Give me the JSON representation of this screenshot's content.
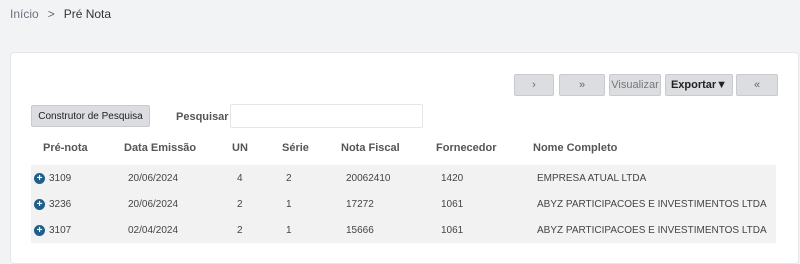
{
  "breadcrumb": {
    "home": "Início",
    "separator": ">",
    "current": "Pré Nota"
  },
  "toolbar": {
    "next": "›",
    "last": "»",
    "visualize": "Visualizar",
    "export": "Exportar▼",
    "collapse": "«"
  },
  "search": {
    "builder_label": "Construtor de Pesquisa",
    "label": "Pesquisar",
    "value": "",
    "placeholder": ""
  },
  "table": {
    "columns": [
      "Pré-nota",
      "Data Emissão",
      "UN",
      "Série",
      "Nota Fiscal",
      "Fornecedor",
      "Nome Completo"
    ],
    "rows": [
      [
        "3109",
        "20/06/2024",
        "4",
        "2",
        "20062410",
        "1420",
        "EMPRESA ATUAL LTDA"
      ],
      [
        "3236",
        "20/06/2024",
        "2",
        "1",
        "17272",
        "1061",
        "ABYZ PARTICIPACOES E INVESTIMENTOS LTDA"
      ],
      [
        "3107",
        "02/04/2024",
        "2",
        "1",
        "15666",
        "1061",
        "ABYZ PARTICIPACOES E INVESTIMENTOS LTDA"
      ]
    ]
  },
  "icons": {
    "expand": "plus-circle-icon",
    "expand_glyph": "+"
  }
}
